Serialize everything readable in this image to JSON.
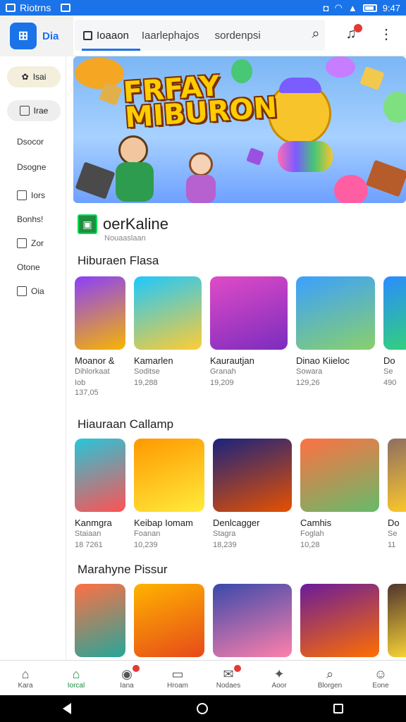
{
  "status": {
    "app_name": "Riotrns",
    "time": "9:47"
  },
  "appbar": {
    "logo_text": "Dia",
    "tabs": [
      {
        "label": "Ioaaon",
        "active": true
      },
      {
        "label": "Iaarlephajos",
        "active": false
      },
      {
        "label": "sordenpsi",
        "active": false
      }
    ]
  },
  "sidebar": {
    "pill1": "Isai",
    "pill2": "Irae",
    "items": [
      "Dsocor",
      "Dsogne",
      "Iors",
      "Bonhs!",
      "Zor",
      "Otone",
      "Oia"
    ]
  },
  "hero": {
    "title_line1": "FRFAY",
    "title_line2": "MIBURON"
  },
  "brand": {
    "name": "oerKaline",
    "subtitle": "Nouaaslaan"
  },
  "sections": [
    {
      "title": "Hiburaen Flasa",
      "cards": [
        {
          "title": "Moanor &",
          "sub": "Dihlorkaat",
          "meta": "Iob",
          "meta2": "137,05"
        },
        {
          "title": "Kamarlen",
          "sub": "Soditse",
          "meta": "19,288"
        },
        {
          "title": "Kaurautjan",
          "sub": "Granah",
          "meta": "19,209"
        },
        {
          "title": "Dinao Kiieloc",
          "sub": "Sowara",
          "meta": "129,26"
        },
        {
          "title": "Do",
          "sub": "Se",
          "meta": "490"
        }
      ]
    },
    {
      "title": "Hiauraan Callamp",
      "cards": [
        {
          "title": "Kanmgra",
          "sub": "Staiaan",
          "meta": "18 7261"
        },
        {
          "title": "Keibap Iomam",
          "sub": "Foanan",
          "meta": "10,239"
        },
        {
          "title": "Denlcagger",
          "sub": "Stagra",
          "meta": "18,239"
        },
        {
          "title": "Camhis",
          "sub": "Foglah",
          "meta": "10,28"
        },
        {
          "title": "Do",
          "sub": "Se",
          "meta": "11"
        }
      ]
    },
    {
      "title": "Marahyne Pissur",
      "cards": [
        {},
        {},
        {},
        {},
        {}
      ]
    }
  ],
  "bottomnav": [
    {
      "label": "Kara",
      "glyph": "⌂",
      "active": false
    },
    {
      "label": "Iorcal",
      "glyph": "⌂",
      "active": true
    },
    {
      "label": "Iana",
      "glyph": "◉",
      "active": false,
      "badge": true
    },
    {
      "label": "Hroam",
      "glyph": "▭",
      "active": false
    },
    {
      "label": "Nodaes",
      "glyph": "✉",
      "active": false,
      "badge": true
    },
    {
      "label": "Aoor",
      "glyph": "✦",
      "active": false
    },
    {
      "label": "Blorgen",
      "glyph": "⌕",
      "active": false
    },
    {
      "label": "Eone",
      "glyph": "☺",
      "active": false
    }
  ],
  "colors": {
    "accent": "#1a73e8",
    "active_green": "#1e8e3e",
    "badge": "#e53935"
  }
}
